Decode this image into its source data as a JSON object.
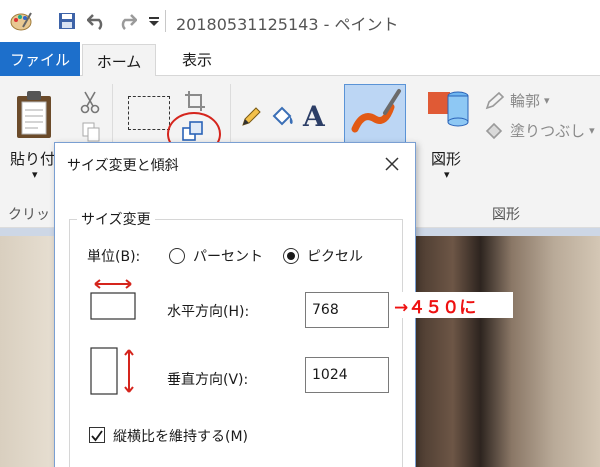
{
  "window": {
    "title": "20180531125143 - ペイント"
  },
  "tabs": {
    "file": "ファイル",
    "home": "ホーム",
    "view": "表示"
  },
  "ribbon": {
    "paste_label": "貼り付",
    "clipboard_group": "クリッ",
    "outline_label": "輪郭",
    "fill_label": "塗りつぶし",
    "shapes_label": "図形",
    "shapes_group": "図形",
    "dropdown_glyph": "▾"
  },
  "dialog": {
    "title": "サイズ変更と傾斜",
    "resize_group": "サイズ変更",
    "unit_label": "単位(B):",
    "percent_label": "パーセント",
    "pixel_label": "ピクセル",
    "horizontal_label": "水平方向(H):",
    "horizontal_value": "768",
    "vertical_label": "垂直方向(V):",
    "vertical_value": "1024",
    "keep_ratio_label": "縦横比を維持する(M)"
  },
  "annotation": {
    "text": "→４５０に"
  },
  "icons": [
    "paint-app-icon",
    "save-icon",
    "undo-icon",
    "redo-icon",
    "customize-quick-access-icon",
    "paste-icon",
    "cut-icon",
    "copy-icon",
    "select-icon",
    "crop-icon",
    "resize-icon",
    "pencil-icon",
    "fill-bucket-icon",
    "text-icon",
    "brushes-icon",
    "shapes-icon",
    "outline-icon",
    "fill-icon",
    "close-icon",
    "horizontal-resize-icon",
    "vertical-resize-icon",
    "checkmark-icon"
  ]
}
